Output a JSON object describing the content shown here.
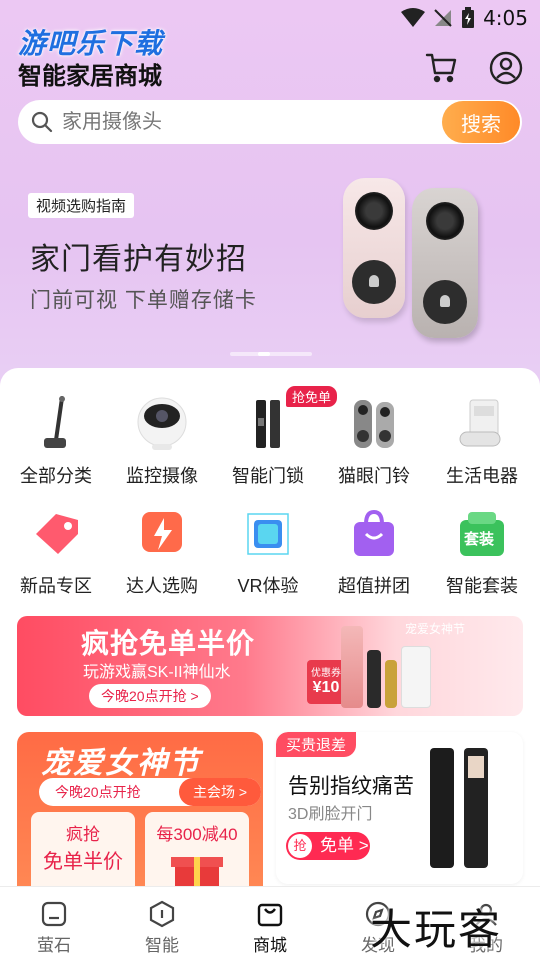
{
  "status_bar": {
    "time": "4:05"
  },
  "header": {
    "watermark": "游吧乐下载",
    "title": "智能家居商城"
  },
  "search": {
    "placeholder": "家用摄像头",
    "button": "搜索"
  },
  "banner": {
    "tag": "视频选购指南",
    "title": "家门看护有妙招",
    "subtitle": "门前可视  下单赠存储卡"
  },
  "categories": [
    {
      "label": "全部分类",
      "icon": "vacuum-icon"
    },
    {
      "label": "监控摄像",
      "icon": "camera-icon"
    },
    {
      "label": "智能门锁",
      "icon": "smart-lock-icon",
      "badge": "抢免单"
    },
    {
      "label": "猫眼门铃",
      "icon": "doorbell-icon"
    },
    {
      "label": "生活电器",
      "icon": "appliance-icon"
    },
    {
      "label": "新品专区",
      "icon": "tag-icon"
    },
    {
      "label": "达人选购",
      "icon": "lightning-icon"
    },
    {
      "label": "VR体验",
      "icon": "vr-cube-icon"
    },
    {
      "label": "超值拼团",
      "icon": "bag-icon"
    },
    {
      "label": "智能套装",
      "icon": "package-icon",
      "icon_text": "套装"
    }
  ],
  "promo": {
    "title": "疯抢免单半价",
    "subtitle": "玩游戏赢SK-II神仙水",
    "button": "今晚20点开抢 >",
    "corner": "宠爱女神节",
    "coupon": "优惠券",
    "coupon_value": "¥10"
  },
  "card_left": {
    "title": "宠爱女神节",
    "pill_left": "今晚20点开抢",
    "pill_right": "主会场 >",
    "mini1_l1": "疯抢",
    "mini1_l2": "免单半价",
    "mini2_l1": "每300减40"
  },
  "card_right": {
    "tag": "买贵退差",
    "title": "告别指纹痛苦",
    "subtitle": "3D刷脸开门",
    "badge": "抢",
    "button": "免单 >"
  },
  "bottom_nav": [
    {
      "label": "萤石",
      "icon": "home-icon"
    },
    {
      "label": "智能",
      "icon": "smart-icon"
    },
    {
      "label": "商城",
      "icon": "shop-bag-icon",
      "active": true
    },
    {
      "label": "发现",
      "icon": "discover-icon"
    },
    {
      "label": "我的",
      "icon": "profile-icon"
    }
  ],
  "corner_watermark": "大玩客",
  "colors": {
    "accent": "#ff8a28",
    "brand_red": "#e8234a",
    "hero_bg": "#ecc8f3"
  }
}
